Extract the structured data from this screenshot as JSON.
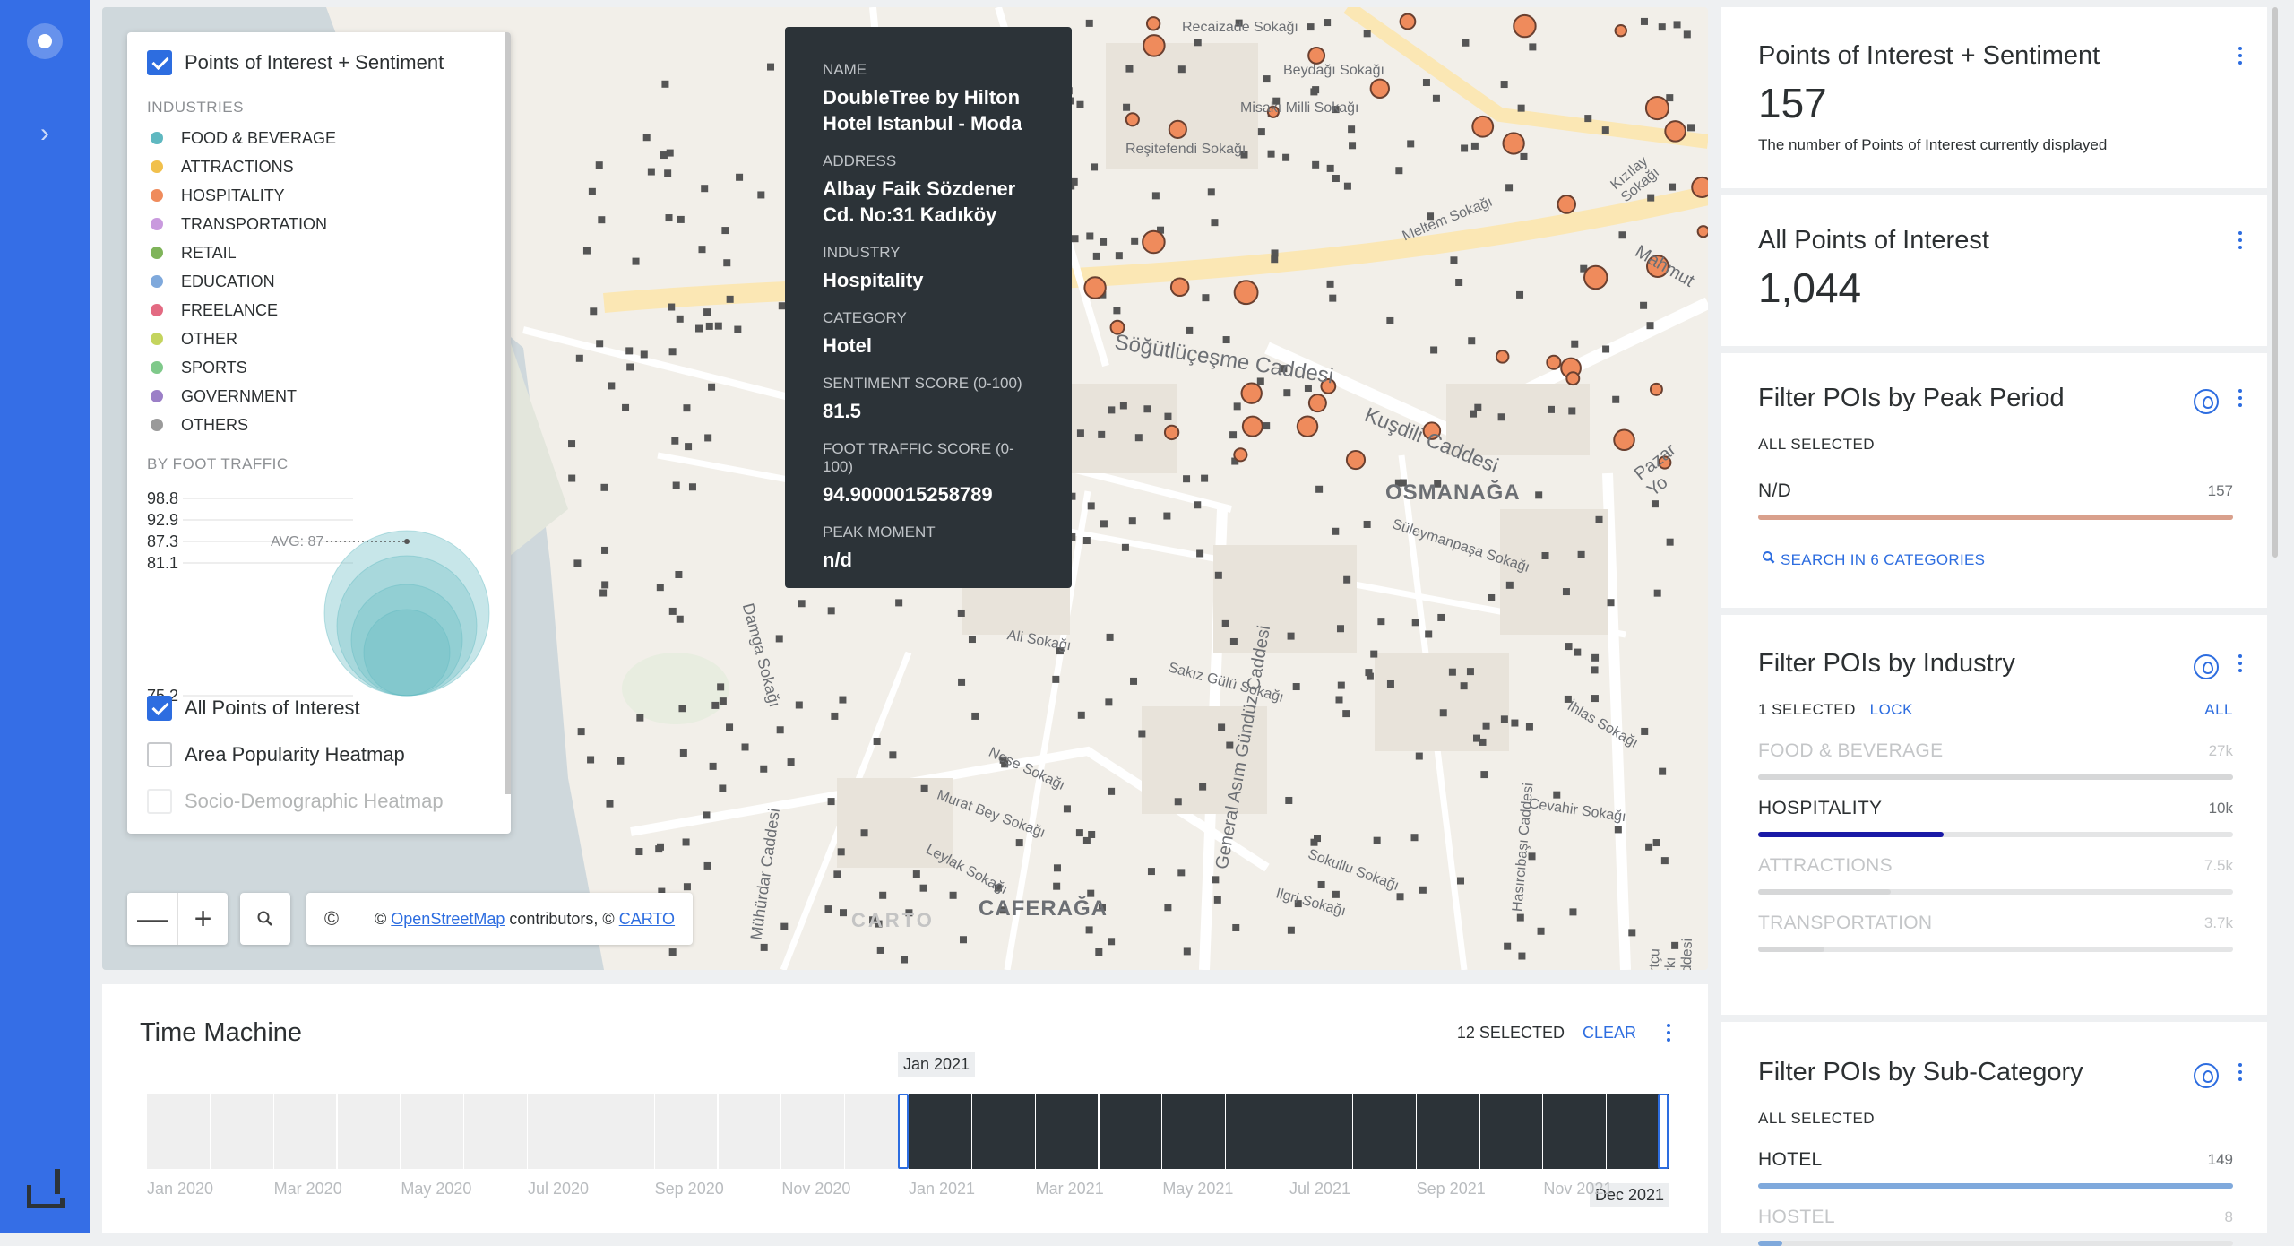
{
  "rail": {
    "icons": [
      "app-logo-icon",
      "chevron-right-icon",
      "carto-brand-icon"
    ]
  },
  "map": {
    "labels": {
      "osmanaga": "OSMANAĞA",
      "caferaga": "CAFERAĞA",
      "sogutlucesme": "Söğütlüçeşme Caddesi",
      "kusdili": "Kuşdili Caddesi",
      "bahariye": "General Asım Gündüz Caddesi",
      "mahmut": "Mahmut",
      "pazar": "Pazar Yo",
      "damga": "Damga Sokağı",
      "muhurdar": "Mühürdar Caddesi",
      "recaizade": "Recaizade Sokağı",
      "beydagi": "Beydağı Sokağı",
      "misakimilli": "Misakı Milli Sokağı",
      "resitefendi": "Reşitefendi Sokağı",
      "meltem": "Meltem Sokağı",
      "kizilay": "Kızılay Sokağı",
      "suleymanpasa": "Süleymanpaşa Sokağı",
      "alisokagi": "Ali Sokağı",
      "sakizgulu": "Sakız Gülü Sokağı",
      "nese": "Neşe Sokağı",
      "muratbey": "Murat Bey Sokağı",
      "leylak": "Leylak Sokağı",
      "sokullu": "Sokullu Sokağı",
      "ilgri": "Ilgri Sokağı",
      "cevahir": "Cevahir Sokağı",
      "ihlas": "İhlas Sokağı",
      "hasircibasi": "Hasırcıbaşı Caddesi",
      "kurtcu": "Kurtçu Parkı Caddesi",
      "carto": "CARTO"
    },
    "controls": {
      "zoom_out": "—",
      "zoom_in": "+",
      "search_icon": "search-icon",
      "copyright": "©",
      "attribution_prefix": "©",
      "osm_link": "OpenStreetMap",
      "attribution_mid": "contributors, ©",
      "carto_link": "CARTO"
    }
  },
  "legend": {
    "layer1": {
      "label": "Points of Interest + Sentiment",
      "checked": true
    },
    "industries_title": "INDUSTRIES",
    "industries": [
      {
        "label": "FOOD & BEVERAGE",
        "color": "#5fb8c0"
      },
      {
        "label": "ATTRACTIONS",
        "color": "#f1c04c"
      },
      {
        "label": "HOSPITALITY",
        "color": "#ef8b5c"
      },
      {
        "label": "TRANSPORTATION",
        "color": "#c99ade"
      },
      {
        "label": "RETAIL",
        "color": "#7fb45a"
      },
      {
        "label": "EDUCATION",
        "color": "#7fa9dc"
      },
      {
        "label": "FREELANCE",
        "color": "#e36a82"
      },
      {
        "label": "OTHER",
        "color": "#c4d45e"
      },
      {
        "label": "SPORTS",
        "color": "#7fc98a"
      },
      {
        "label": "GOVERNMENT",
        "color": "#9b7fc7"
      },
      {
        "label": "OTHERS",
        "color": "#9a9a9a"
      }
    ],
    "foot_traffic_title": "BY FOOT TRAFFIC",
    "bubble_ticks": [
      "98.8",
      "92.9",
      "87.3",
      "81.1",
      "75.2"
    ],
    "avg_label": "AVG: 87",
    "layer2": {
      "label": "All Points of Interest",
      "checked": true
    },
    "layer3": {
      "label": "Area Popularity Heatmap",
      "checked": false
    },
    "layer4": {
      "label": "Socio-Demographic Heatmap",
      "checked": false
    }
  },
  "tooltip": {
    "name_key": "NAME",
    "name_val": "DoubleTree by Hilton Hotel Istanbul - Moda",
    "address_key": "ADDRESS",
    "address_val": "Albay Faik Sözdener Cd. No:31 Kadıköy",
    "industry_key": "INDUSTRY",
    "industry_val": "Hospitality",
    "category_key": "CATEGORY",
    "category_val": "Hotel",
    "sentiment_key": "SENTIMENT SCORE (0-100)",
    "sentiment_val": "81.5",
    "foot_key": "FOOT TRAFFIC SCORE (0-100)",
    "foot_val": "94.9000015258789",
    "peak_key": "PEAK MOMENT",
    "peak_val": "n/d"
  },
  "time_machine": {
    "title": "Time Machine",
    "selected": "12 SELECTED",
    "clear": "CLEAR",
    "start_flag": "Jan 2021",
    "end_flag": "Dec 2021",
    "axis_labels": [
      "Jan 2020",
      "Mar 2020",
      "May 2020",
      "Jul 2020",
      "Sep 2020",
      "Nov 2020",
      "Jan 2021",
      "Mar 2021",
      "May 2021",
      "Jul 2021",
      "Sep 2021",
      "Nov 2021"
    ],
    "months_total": 24,
    "selected_range": [
      12,
      23
    ]
  },
  "sidebar": {
    "w1": {
      "title": "Points of Interest + Sentiment",
      "value": "157",
      "note": "The number of Points of Interest currently displayed"
    },
    "w2": {
      "title": "All Points of Interest",
      "value": "1,044"
    },
    "w3": {
      "title": "Filter POIs by Peak Period",
      "sub": "ALL SELECTED",
      "rows": [
        {
          "label": "N/D",
          "count": "157",
          "fraction": 1.0,
          "color": "#d9a08c",
          "dim": false
        }
      ],
      "search": "SEARCH IN 6 CATEGORIES"
    },
    "w4": {
      "title": "Filter POIs by Industry",
      "sub": "1 SELECTED",
      "lock": "LOCK",
      "all": "ALL",
      "rows": [
        {
          "label": "FOOD & BEVERAGE",
          "count": "27k",
          "fraction": 1.0,
          "color": "#d6d7d8",
          "dim": true
        },
        {
          "label": "HOSPITALITY",
          "count": "10k",
          "fraction": 0.39,
          "color": "#1a1aa6",
          "dim": false
        },
        {
          "label": "ATTRACTIONS",
          "count": "7.5k",
          "fraction": 0.28,
          "color": "#d6d7d8",
          "dim": true
        },
        {
          "label": "TRANSPORTATION",
          "count": "3.7k",
          "fraction": 0.14,
          "color": "#d6d7d8",
          "dim": true
        }
      ]
    },
    "w5": {
      "title": "Filter POIs by Sub-Category",
      "sub": "ALL SELECTED",
      "rows": [
        {
          "label": "HOTEL",
          "count": "149",
          "fraction": 1.0,
          "color": "#7fa9dc",
          "dim": false
        },
        {
          "label": "HOSTEL",
          "count": "8",
          "fraction": 0.05,
          "color": "#7fa9dc",
          "dim": true
        }
      ]
    }
  }
}
